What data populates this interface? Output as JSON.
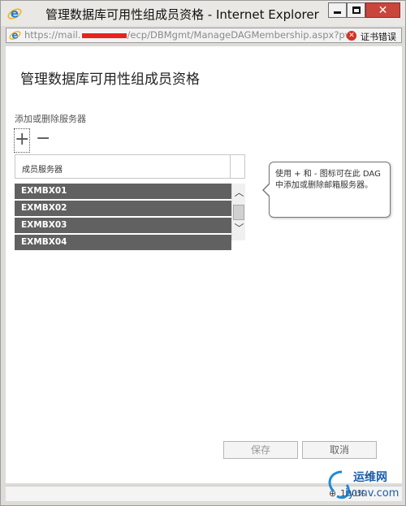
{
  "window": {
    "title": "管理数据库可用性组成员资格 - Internet Explorer",
    "address_prefix": "https://mail.",
    "address_suffix": "/ecp/DBMgmt/ManageDAGMembership.aspx?pw",
    "cert_error": "证书错误"
  },
  "dialog": {
    "title": "管理数据库可用性组成员资格",
    "section_label": "添加或删除服务器",
    "add_glyph": "+",
    "remove_glyph": "−",
    "column_header": "成员服务器",
    "servers": [
      "EXMBX01",
      "EXMBX02",
      "EXMBX03",
      "EXMBX04"
    ],
    "tooltip": "使用 + 和 - 图标可在此 DAG 中添加或删除邮箱服务器。",
    "save_label": "保存",
    "cancel_label": "取消"
  },
  "statusbar": {
    "zoom": "100%"
  },
  "watermark": {
    "brand": "运维网",
    "site": "iyunv.com"
  },
  "colors": {
    "row_bg": "#616161",
    "close_button": "#c9463d",
    "ie_blue": "#1f7fd6"
  }
}
